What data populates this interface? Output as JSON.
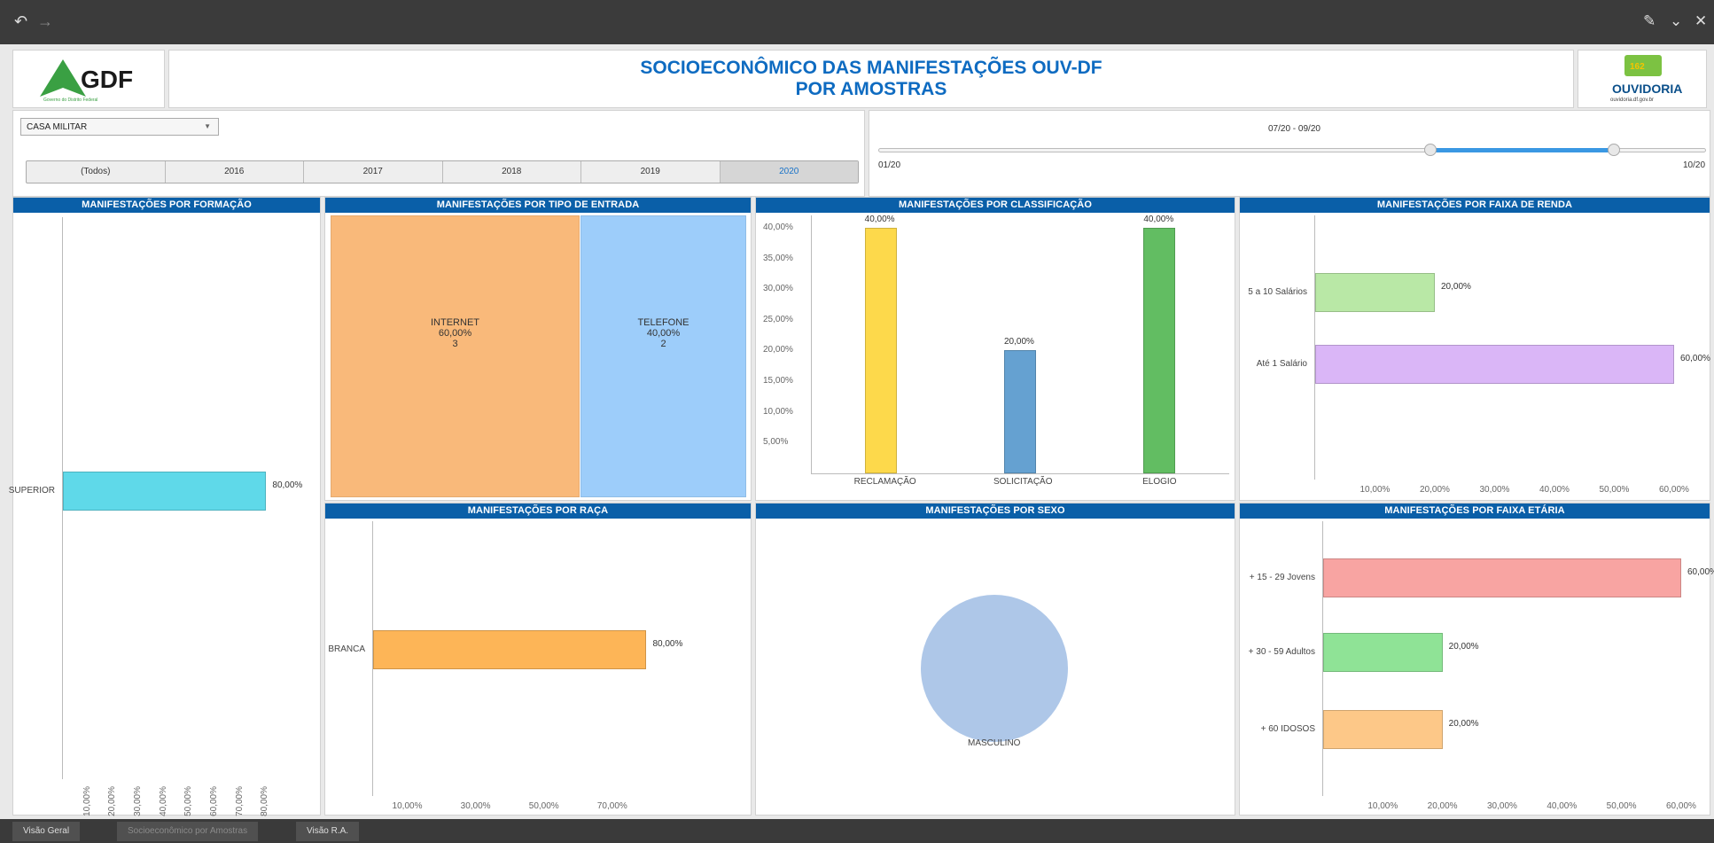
{
  "header": {
    "logo_left": "GDF",
    "logo_left_sub": "Governo do Distrito Federal",
    "title_line1": "SOCIOECONÔMICO DAS MANIFESTAÇÕES OUV-DF",
    "title_line2": "POR AMOSTRAS",
    "logo_right": "OUVIDORIA",
    "logo_right_sub": "ouvidoria.df.gov.br",
    "logo_right_badge": "162"
  },
  "filters": {
    "select_value": "CASA MILITAR",
    "years": [
      "(Todos)",
      "2016",
      "2017",
      "2018",
      "2019",
      "2020"
    ],
    "selected_year": "2020",
    "range_label": "07/20 - 09/20",
    "range_min_label": "01/20",
    "range_max_label": "10/20",
    "range_start_fraction": 0.6667,
    "range_end_fraction": 0.8889
  },
  "charts": {
    "formacao": {
      "title": "MANIFESTAÇÕES POR FORMAÇÃO",
      "categories": [
        "SUPERIOR"
      ],
      "values": [
        80
      ],
      "value_labels": [
        "80,00%"
      ],
      "ticks": [
        "10,00%",
        "20,00%",
        "30,00%",
        "40,00%",
        "50,00%",
        "60,00%",
        "70,00%",
        "80,00%"
      ],
      "color": "#5fd9e9"
    },
    "tipo_entrada": {
      "title": "MANIFESTAÇÕES POR TIPO DE ENTRADA",
      "items": [
        {
          "name": "INTERNET",
          "pct": "60,00%",
          "count": "3",
          "value": 60,
          "color": "#f9b97a"
        },
        {
          "name": "TELEFONE",
          "pct": "40,00%",
          "count": "2",
          "value": 40,
          "color": "#9dcdfa"
        }
      ]
    },
    "classificacao": {
      "title": "MANIFESTAÇÕES POR CLASSIFICAÇÃO",
      "categories": [
        "RECLAMAÇÃO",
        "SOLICITAÇÃO",
        "ELOGIO"
      ],
      "values": [
        40,
        20,
        40
      ],
      "value_labels": [
        "40,00%",
        "20,00%",
        "40,00%"
      ],
      "colors": [
        "#fdd94b",
        "#65a1d1",
        "#62bd62"
      ],
      "ticks": [
        "5,00%",
        "10,00%",
        "15,00%",
        "20,00%",
        "25,00%",
        "30,00%",
        "35,00%",
        "40,00%"
      ]
    },
    "renda": {
      "title": "MANIFESTAÇÕES POR FAIXA DE RENDA",
      "categories": [
        "5 a 10 Salários",
        "Até 1 Salário"
      ],
      "values": [
        20,
        60
      ],
      "value_labels": [
        "20,00%",
        "60,00%"
      ],
      "colors": [
        "#b9e8a6",
        "#dab6f7"
      ],
      "ticks": [
        "10,00%",
        "20,00%",
        "30,00%",
        "40,00%",
        "50,00%",
        "60,00%"
      ]
    },
    "raca": {
      "title": "MANIFESTAÇÕES POR RAÇA",
      "categories": [
        "BRANCA"
      ],
      "values": [
        80
      ],
      "value_labels": [
        "80,00%"
      ],
      "color": "#fdb557",
      "ticks": [
        "10,00%",
        "30,00%",
        "50,00%",
        "70,00%"
      ]
    },
    "sexo": {
      "title": "MANIFESTAÇÕES POR SEXO",
      "items": [
        {
          "name": "MASCULINO",
          "value": 100,
          "color": "#aec7e8"
        }
      ]
    },
    "etaria": {
      "title": "MANIFESTAÇÕES POR FAIXA ETÁRIA",
      "categories": [
        "+ 15 - 29 Jovens",
        "+ 30 - 59 Adultos",
        "+ 60 IDOSOS"
      ],
      "values": [
        60,
        20,
        20
      ],
      "value_labels": [
        "60,00%",
        "20,00%",
        "20,00%"
      ],
      "colors": [
        "#f8a4a2",
        "#8fe396",
        "#fdc888"
      ],
      "ticks": [
        "10,00%",
        "20,00%",
        "30,00%",
        "40,00%",
        "50,00%",
        "60,00%"
      ]
    }
  },
  "tabs": [
    "Visão Geral",
    "Socioeconômico por Amostras",
    "Visão R.A."
  ],
  "active_tab": "Socioeconômico por Amostras"
}
